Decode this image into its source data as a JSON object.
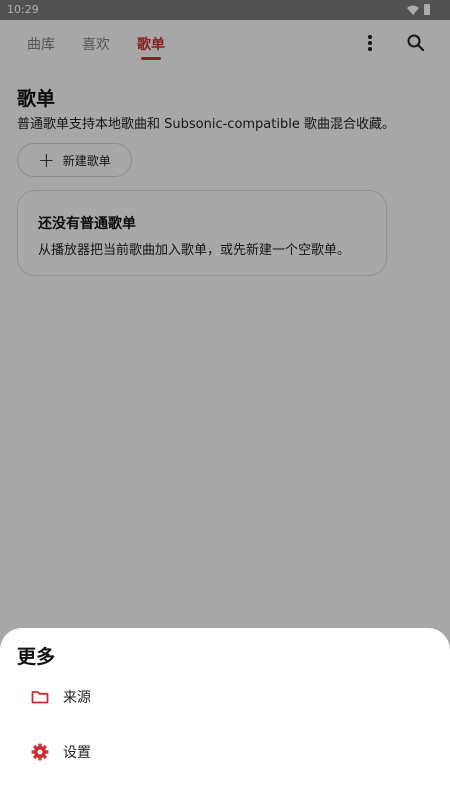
{
  "status_bar": {
    "time": "10:29"
  },
  "tabs": [
    {
      "label": "曲库",
      "active": false
    },
    {
      "label": "喜欢",
      "active": false
    },
    {
      "label": "歌单",
      "active": true
    }
  ],
  "toolbar": {
    "more_icon": "more-vert-icon",
    "search_icon": "search-icon"
  },
  "page": {
    "title": "歌单",
    "description": "普通歌单支持本地歌曲和 Subsonic-compatible 歌曲混合收藏。",
    "new_playlist_label": "新建歌单"
  },
  "empty_state": {
    "title": "还没有普通歌单",
    "description": "从播放器把当前歌曲加入歌单，或先新建一个空歌单。"
  },
  "sheet": {
    "title": "更多",
    "items": [
      {
        "label": "来源",
        "icon": "folder-icon"
      },
      {
        "label": "设置",
        "icon": "gear-icon"
      }
    ]
  },
  "colors": {
    "accent": "#c63031",
    "scrim": "rgba(0,0,0,0.32)"
  }
}
